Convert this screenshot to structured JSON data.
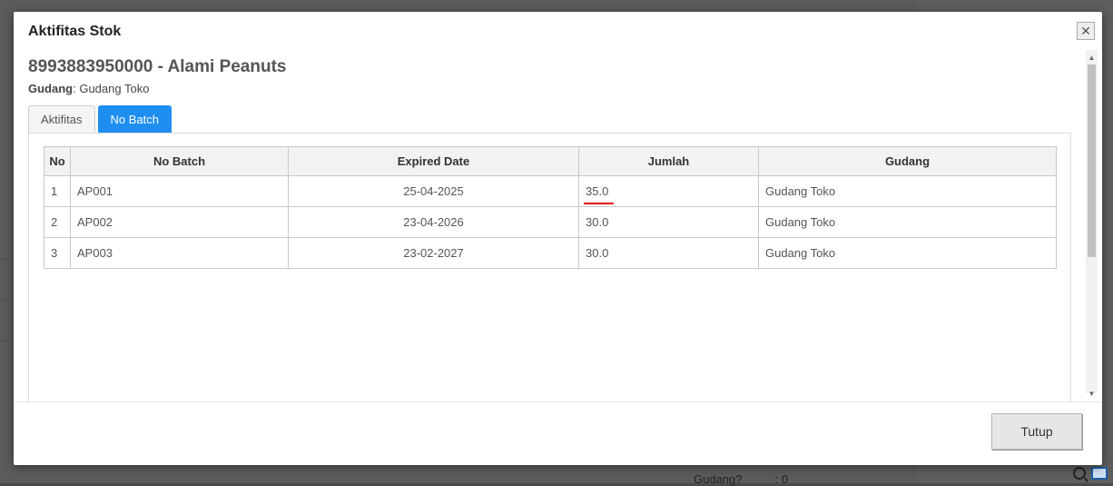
{
  "dialog": {
    "title": "Aktifitas Stok",
    "product_title": "8993883950000 - Alami Peanuts",
    "warehouse_label": "Gudang",
    "warehouse_value": "Gudang Toko"
  },
  "tabs": [
    {
      "label": "Aktifitas",
      "active": false
    },
    {
      "label": "No Batch",
      "active": true
    }
  ],
  "table": {
    "headers": [
      "No",
      "No Batch",
      "Expired Date",
      "Jumlah",
      "Gudang"
    ],
    "rows": [
      {
        "no": "1",
        "batch": "AP001",
        "expired": "25-04-2025",
        "jumlah": "35.0",
        "gudang": "Gudang Toko"
      },
      {
        "no": "2",
        "batch": "AP002",
        "expired": "23-04-2026",
        "jumlah": "30.0",
        "gudang": "Gudang Toko"
      },
      {
        "no": "3",
        "batch": "AP003",
        "expired": "23-02-2027",
        "jumlah": "30.0",
        "gudang": "Gudang Toko"
      }
    ]
  },
  "footer": {
    "close_label": "Tutup"
  },
  "background": {
    "partial_text": "Gudang?          : 0"
  },
  "icons": {
    "close": "close-icon",
    "search": "search-icon",
    "list": "list-icon"
  },
  "colors": {
    "active_tab": "#1f8ef1",
    "highlight": "#dd0000"
  }
}
